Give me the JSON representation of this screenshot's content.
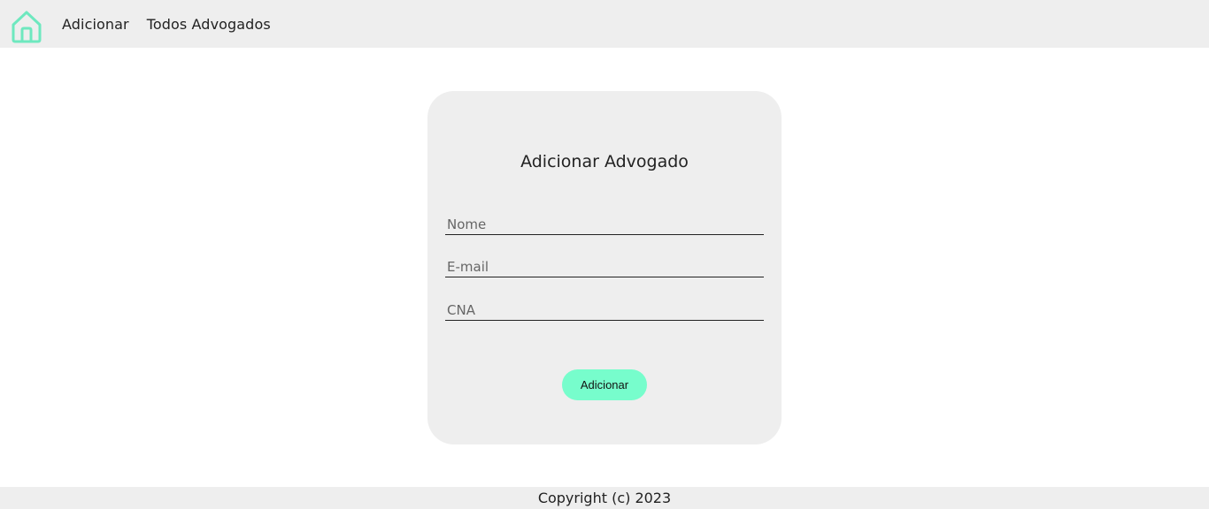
{
  "navbar": {
    "home_icon": "home-icon",
    "links": [
      {
        "label": "Adicionar"
      },
      {
        "label": "Todos Advogados"
      }
    ]
  },
  "form": {
    "title": "Adicionar Advogado",
    "fields": {
      "nome": {
        "placeholder": "Nome",
        "value": ""
      },
      "email": {
        "placeholder": "E-mail",
        "value": ""
      },
      "cna": {
        "placeholder": "CNA",
        "value": ""
      }
    },
    "submit_label": "Adicionar"
  },
  "footer": {
    "text": "Copyright (c) 2023"
  },
  "colors": {
    "accent": "#77fdcc",
    "icon": "#6ee8bf",
    "panel": "#eeeeee",
    "text": "#222222"
  }
}
